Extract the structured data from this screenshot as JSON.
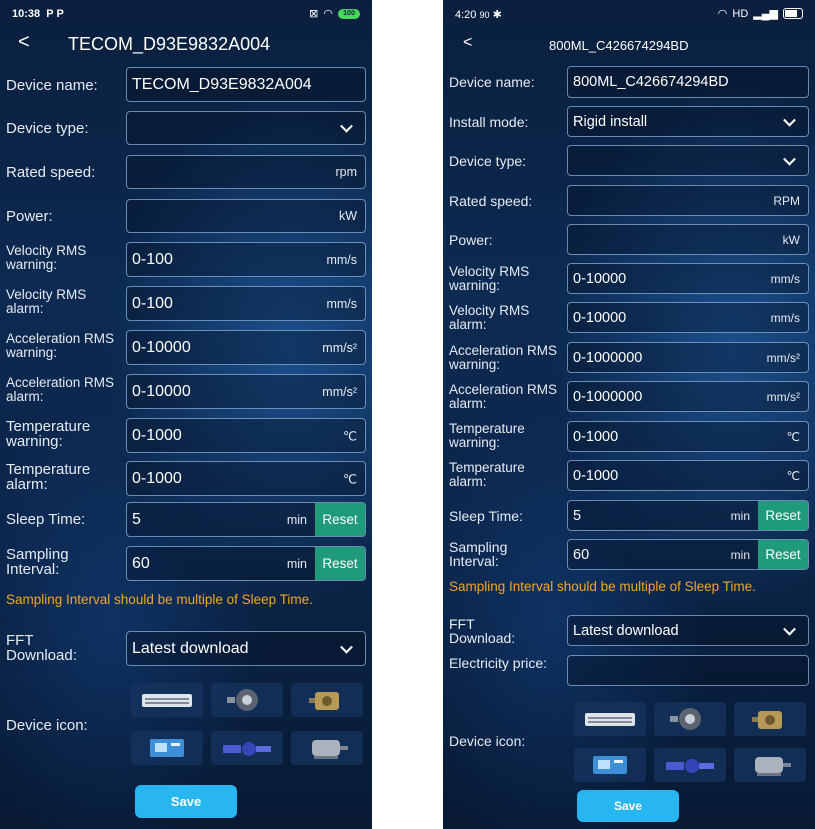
{
  "phone1": {
    "status": {
      "time": "10:38",
      "notif_icons": "P P",
      "battery": "100"
    },
    "header": {
      "title": "TECOM_D93E9832A004"
    },
    "device_name": {
      "label": "Device name:",
      "value": "TECOM_D93E9832A004"
    },
    "device_type": {
      "label": "Device type:",
      "value": ""
    },
    "rated_speed": {
      "label": "Rated speed:",
      "value": "",
      "unit": "rpm"
    },
    "power": {
      "label": "Power:",
      "value": "",
      "unit": "kW"
    },
    "velocity_warning": {
      "label": "Velocity RMS warning:",
      "value": "0-100",
      "unit": "mm/s"
    },
    "velocity_alarm": {
      "label": "Velocity RMS alarm:",
      "value": "0-100",
      "unit": "mm/s"
    },
    "accel_warning": {
      "label": "Acceleration RMS warning:",
      "value": "0-10000",
      "unit": "mm/s²"
    },
    "accel_alarm": {
      "label": "Acceleration RMS alarm:",
      "value": "0-10000",
      "unit": "mm/s²"
    },
    "temp_warning": {
      "label": "Temperature warning:",
      "value": "0-1000",
      "unit": "℃"
    },
    "temp_alarm": {
      "label": "Temperature alarm:",
      "value": "0-1000",
      "unit": "℃"
    },
    "sleep_time": {
      "label": "Sleep Time:",
      "value": "5",
      "unit": "min",
      "reset": "Reset"
    },
    "sampling": {
      "label": "Sampling Interval:",
      "value": "60",
      "unit": "min",
      "reset": "Reset"
    },
    "hint": "Sampling Interval should be multiple of Sleep Time.",
    "fft": {
      "label": "FFT Download:",
      "value": "Latest download"
    },
    "device_icon_label": "Device icon:",
    "save_label": "Save"
  },
  "phone2": {
    "status": {
      "time": "4:20",
      "extra": "90",
      "right": "HD"
    },
    "header": {
      "title": "800ML_C426674294BD"
    },
    "device_name": {
      "label": "Device name:",
      "value": "800ML_C426674294BD"
    },
    "install_mode": {
      "label": "Install mode:",
      "value": "Rigid install"
    },
    "device_type": {
      "label": "Device type:",
      "value": ""
    },
    "rated_speed": {
      "label": "Rated speed:",
      "value": "",
      "unit": "RPM"
    },
    "power": {
      "label": "Power:",
      "value": "",
      "unit": "kW"
    },
    "velocity_warning": {
      "label": "Velocity RMS warning:",
      "value": "0-10000",
      "unit": "mm/s"
    },
    "velocity_alarm": {
      "label": "Velocity RMS alarm:",
      "value": "0-10000",
      "unit": "mm/s"
    },
    "accel_warning": {
      "label": "Acceleration RMS warning:",
      "value": "0-1000000",
      "unit": "mm/s²"
    },
    "accel_alarm": {
      "label": "Acceleration RMS alarm:",
      "value": "0-1000000",
      "unit": "mm/s²"
    },
    "temp_warning": {
      "label": "Temperature warning:",
      "value": "0-1000",
      "unit": "℃"
    },
    "temp_alarm": {
      "label": "Temperature alarm:",
      "value": "0-1000",
      "unit": "℃"
    },
    "sleep_time": {
      "label": "Sleep Time:",
      "value": "5",
      "unit": "min",
      "reset": "Reset"
    },
    "sampling": {
      "label": "Sampling Interval:",
      "value": "60",
      "unit": "min",
      "reset": "Reset"
    },
    "hint": "Sampling Interval should be multiple of Sleep Time.",
    "fft": {
      "label": "FFT Download:",
      "value": "Latest download"
    },
    "electricity": {
      "label": "Electricity price:",
      "value": ""
    },
    "device_icon_label": "Device icon:",
    "save_label": "Save"
  },
  "device_icons": [
    "air-conditioner-icon",
    "fan-motor-icon",
    "gearbox-icon",
    "cnc-machine-icon",
    "pump-icon",
    "electric-motor-icon"
  ]
}
